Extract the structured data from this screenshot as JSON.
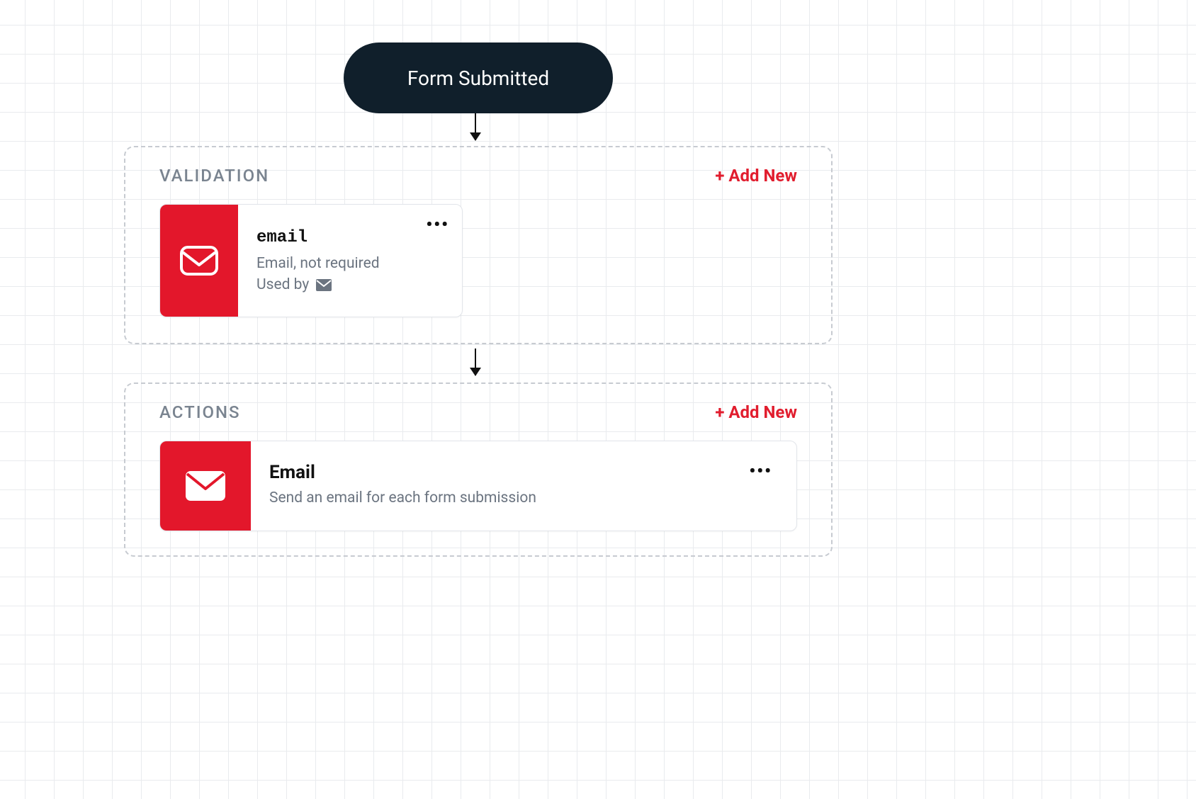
{
  "trigger": {
    "label": "Form Submitted"
  },
  "validation": {
    "title": "VALIDATION",
    "add_new_label": "+ Add New",
    "card": {
      "title": "email",
      "type_line": "Email, not required",
      "used_by_label": "Used by",
      "dots": "•••"
    }
  },
  "actions": {
    "title": "ACTIONS",
    "add_new_label": "+ Add New",
    "card": {
      "title": "Email",
      "description": "Send an email for each form submission",
      "dots": "•••"
    }
  },
  "colors": {
    "accent_red": "#e3172b",
    "trigger_bg": "#101f2b",
    "muted_text": "#6b7480",
    "panel_border": "#c7cbd1"
  }
}
